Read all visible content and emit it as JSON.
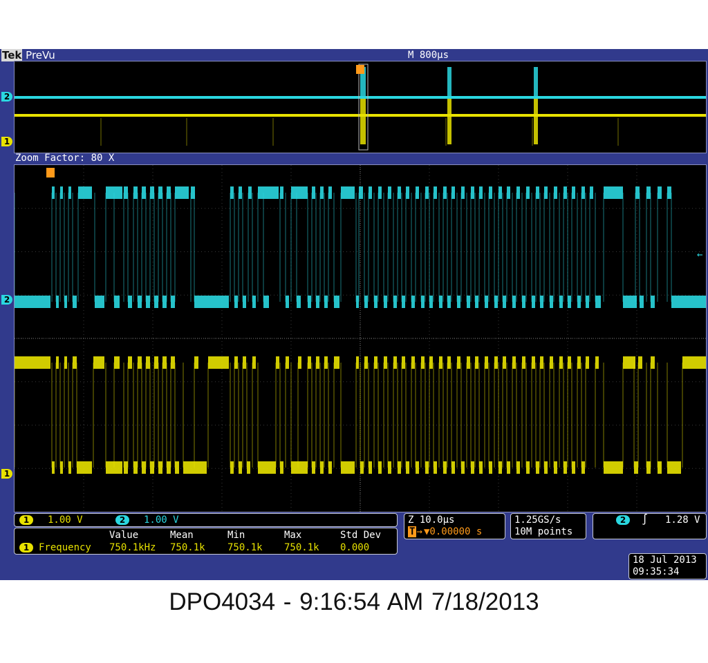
{
  "header": {
    "brand": "Tek",
    "mode": "PreVu",
    "timebase": "M 800µs"
  },
  "zoom": {
    "label": "Zoom Factor: 80 X"
  },
  "markers": {
    "trigger": "T",
    "ch1": "1",
    "ch2": "2"
  },
  "channels": [
    {
      "id": "1",
      "scale": "1.00 V",
      "color": "#e8e200"
    },
    {
      "id": "2",
      "scale": "1.00 V",
      "color": "#2ad7e0"
    }
  ],
  "measurements": {
    "headers": [
      "Value",
      "Mean",
      "Min",
      "Max",
      "Std Dev"
    ],
    "row": {
      "channel": "1",
      "name": "Frequency",
      "values": [
        "750.1kHz",
        "750.1k",
        "750.1k",
        "750.1k",
        "0.000"
      ]
    }
  },
  "horizontal": {
    "zoom_scale": "Z 10.0µs",
    "position": "▼0.00000 s"
  },
  "acquisition": {
    "sample_rate": "1.25GS/s",
    "record_length": "10M points"
  },
  "trigger": {
    "source": "2",
    "slope_icon": "rising-edge",
    "level": "1.28 V"
  },
  "datetime": {
    "date": "18 Jul  2013",
    "time": "09:35:34"
  },
  "caption": "DPO4034 - 9:16:54 AM   7/18/2013"
}
